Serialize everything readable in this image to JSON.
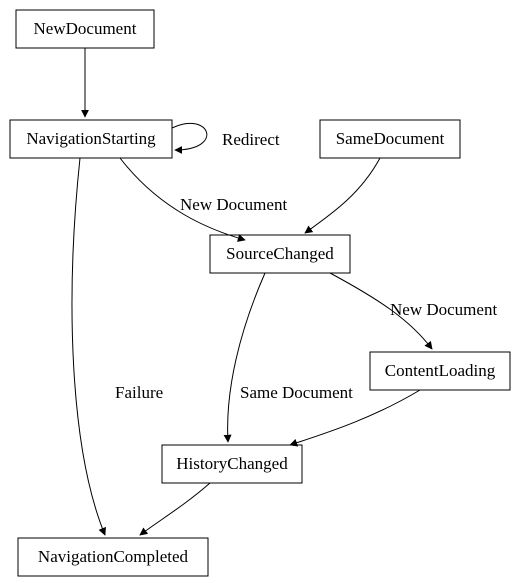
{
  "chart_data": {
    "type": "graph",
    "title": "",
    "nodes": [
      {
        "id": "NewDocument",
        "label": "NewDocument"
      },
      {
        "id": "NavigationStarting",
        "label": "NavigationStarting"
      },
      {
        "id": "SameDocument",
        "label": "SameDocument"
      },
      {
        "id": "SourceChanged",
        "label": "SourceChanged"
      },
      {
        "id": "ContentLoading",
        "label": "ContentLoading"
      },
      {
        "id": "HistoryChanged",
        "label": "HistoryChanged"
      },
      {
        "id": "NavigationCompleted",
        "label": "NavigationCompleted"
      }
    ],
    "edges": [
      {
        "from": "NewDocument",
        "to": "NavigationStarting",
        "label": ""
      },
      {
        "from": "NavigationStarting",
        "to": "NavigationStarting",
        "label": "Redirect"
      },
      {
        "from": "NavigationStarting",
        "to": "SourceChanged",
        "label": "New Document"
      },
      {
        "from": "NavigationStarting",
        "to": "NavigationCompleted",
        "label": "Failure"
      },
      {
        "from": "SameDocument",
        "to": "SourceChanged",
        "label": ""
      },
      {
        "from": "SourceChanged",
        "to": "ContentLoading",
        "label": "New Document"
      },
      {
        "from": "SourceChanged",
        "to": "HistoryChanged",
        "label": "Same Document"
      },
      {
        "from": "ContentLoading",
        "to": "HistoryChanged",
        "label": ""
      },
      {
        "from": "HistoryChanged",
        "to": "NavigationCompleted",
        "label": ""
      }
    ]
  },
  "nodes": {
    "NewDocument": "NewDocument",
    "NavigationStarting": "NavigationStarting",
    "SameDocument": "SameDocument",
    "SourceChanged": "SourceChanged",
    "ContentLoading": "ContentLoading",
    "HistoryChanged": "HistoryChanged",
    "NavigationCompleted": "NavigationCompleted"
  },
  "edgeLabels": {
    "redirect": "Redirect",
    "newDocument1": "New Document",
    "newDocument2": "New Document",
    "failure": "Failure",
    "sameDocument": "Same Document"
  }
}
